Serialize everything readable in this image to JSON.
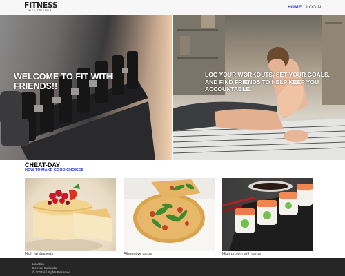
{
  "nav": {
    "logo_main": "FITNESS",
    "logo_sub": "WITH FRIENDS",
    "links": [
      {
        "label": "HOME",
        "active": true
      },
      {
        "label": "LOGIN",
        "active": false
      }
    ]
  },
  "hero": {
    "left_text": "WELCOME TO FIT WITH FRIENDS!!",
    "right_text": "LOG YOUR WORKOUTS, SET YOUR GOALS, AND FIND FRIENDS TO HELP KEEP YOU ACCOUNTABLE."
  },
  "cheat_day": {
    "title": "CHEAT-DAY",
    "link": "HOW TO MAKE GOOD CHOICES",
    "cards": [
      {
        "caption": "High fat desserts",
        "image": "cheesecake-image"
      },
      {
        "caption": "Alternative carbs",
        "image": "pizza-image"
      },
      {
        "caption": "High protein with carbs",
        "image": "sushi-image"
      }
    ]
  },
  "footer": {
    "label": "Location",
    "city": "Denver, Colorado",
    "copyright": "© 2022 All Rights Reserved"
  },
  "colors": {
    "accent_blue": "#1a2fd9",
    "footer_bg": "#262626",
    "nav_bg": "#f7f7f7"
  }
}
